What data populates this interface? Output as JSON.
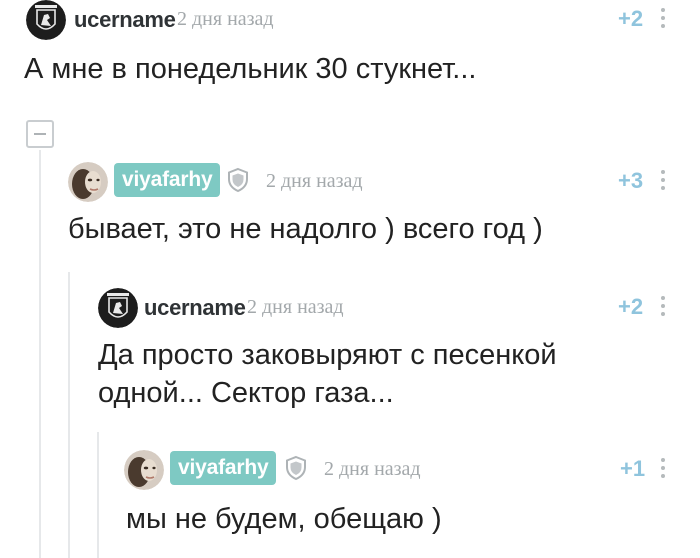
{
  "comments": [
    {
      "username": "ucername",
      "time": "2 дня назад",
      "rating": "+2",
      "text": "А мне в понедельник 30 стукнет..."
    },
    {
      "username": "viyafarhy",
      "time": "2 дня назад",
      "rating": "+3",
      "text": "бывает, это не надолго ) всего год )"
    },
    {
      "username": "ucername",
      "time": "2 дня назад",
      "rating": "+2",
      "text_line1": "Да просто заковыряют с песенкой",
      "text_line2": "одной... Сектор газа..."
    },
    {
      "username": "viyafarhy",
      "time": "2 дня назад",
      "rating": "+1",
      "text": "мы не будем, обещаю )"
    }
  ],
  "colors": {
    "username_badge": "#7ec9c3",
    "rating": "#8fc4dd",
    "time": "#a3a8ab",
    "thread_line": "#e6e8ea"
  },
  "icons": [
    "avatar-dark-emblem",
    "avatar-photo",
    "shield-icon",
    "more-vertical-icon",
    "collapse-minus-icon"
  ]
}
